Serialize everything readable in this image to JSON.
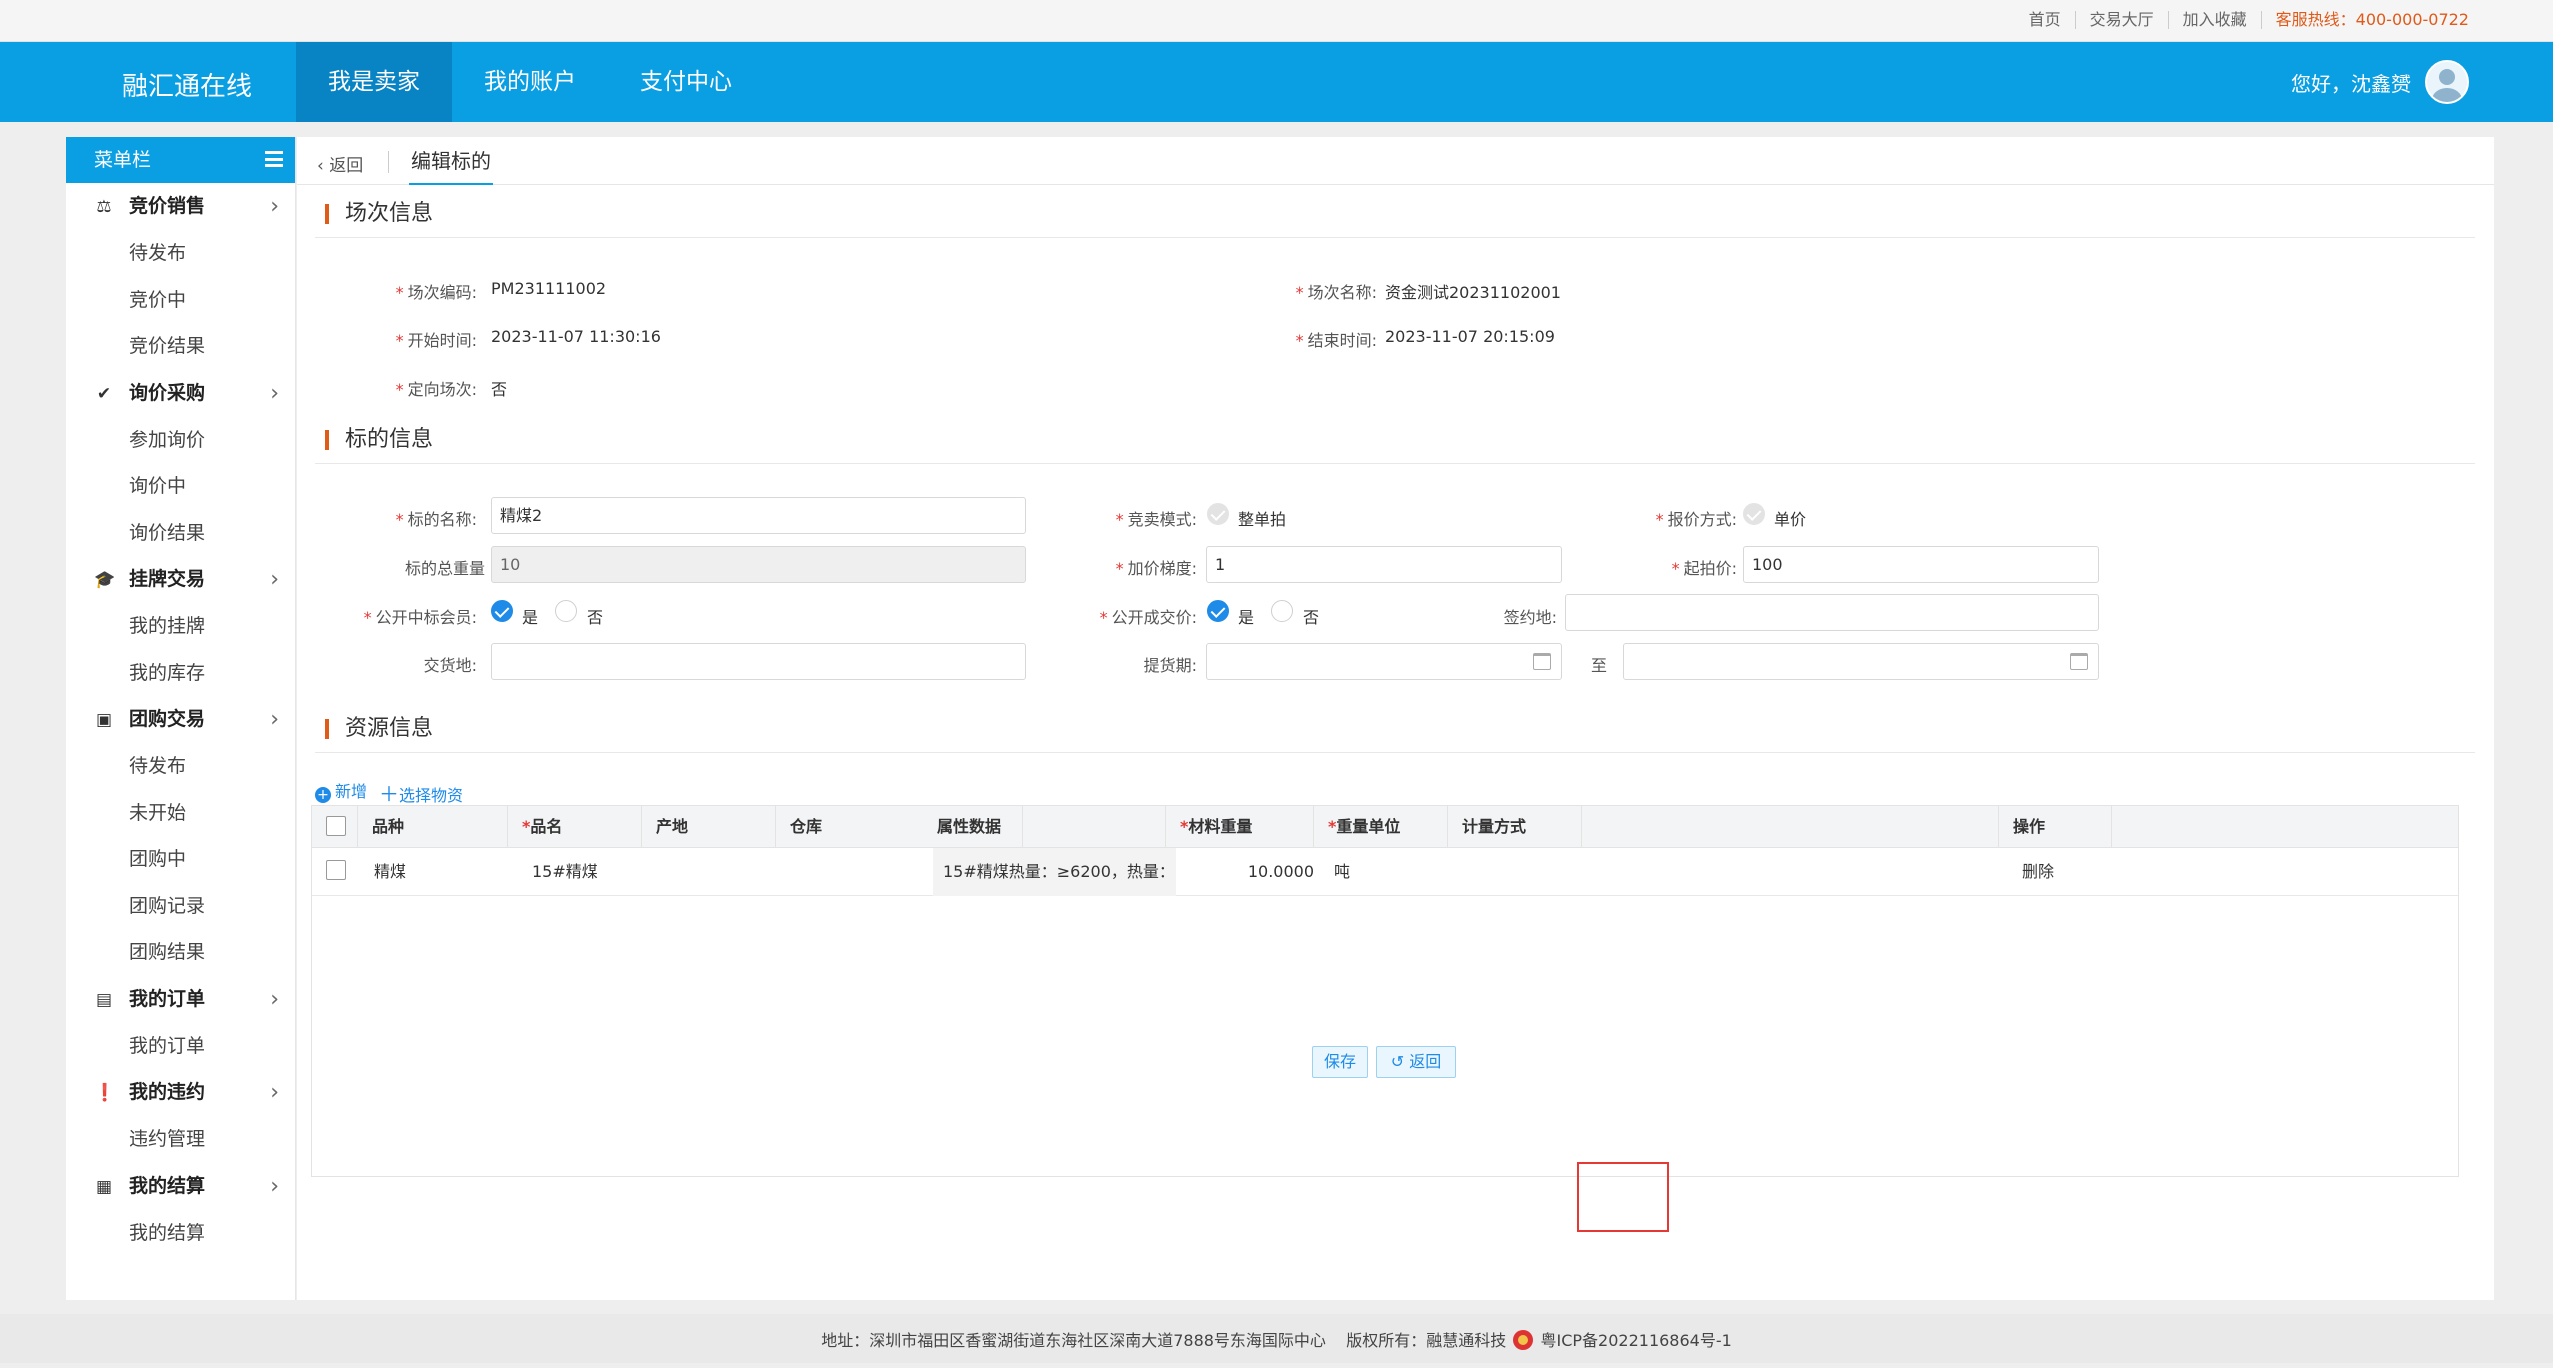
{
  "topbar": {
    "home": "首页",
    "trade_hall": "交易大厅",
    "favorite": "加入收藏",
    "hotline": "客服热线：400-000-0722"
  },
  "header": {
    "brand": "融汇通在线",
    "nav": [
      "我是卖家",
      "我的账户",
      "支付中心"
    ],
    "greeting": "您好，沈鑫赟"
  },
  "sidebar": {
    "title": "菜单栏",
    "groups": [
      {
        "label": "竞价销售",
        "icon": "gavel-icon",
        "items": [
          "待发布",
          "竞价中",
          "竞价结果"
        ]
      },
      {
        "label": "询价采购",
        "icon": "check-circle-icon",
        "items": [
          "参加询价",
          "询价中",
          "询价结果"
        ]
      },
      {
        "label": "挂牌交易",
        "icon": "graduation-cap-icon",
        "items": [
          "我的挂牌",
          "我的库存"
        ]
      },
      {
        "label": "团购交易",
        "icon": "cart-box-icon",
        "items": [
          "待发布",
          "未开始",
          "团购中",
          "团购记录",
          "团购结果"
        ]
      },
      {
        "label": "我的订单",
        "icon": "document-icon",
        "items": [
          "我的订单"
        ]
      },
      {
        "label": "我的违约",
        "icon": "alert-icon",
        "items": [
          "违约管理"
        ]
      },
      {
        "label": "我的结算",
        "icon": "calculator-icon",
        "items": [
          "我的结算"
        ]
      }
    ]
  },
  "tabs": {
    "back": "返回",
    "current": "编辑标的"
  },
  "session_info": {
    "title": "场次信息",
    "code_label": "场次编码:",
    "code": "PM231111002",
    "name_label": "场次名称:",
    "name": "资金测试20231102001",
    "start_label": "开始时间:",
    "start": "2023-11-07 11:30:16",
    "end_label": "结束时间:",
    "end": "2023-11-07 20:15:09",
    "directed_label": "定向场次:",
    "directed": "否"
  },
  "target_info": {
    "title": "标的信息",
    "name_label": "标的名称:",
    "name": "精煤2",
    "mode_label": "竞卖模式:",
    "mode": "整单拍",
    "quote_label": "报价方式:",
    "quote": "单价",
    "total_label": "标的总重量",
    "total": "10",
    "step_label": "加价梯度:",
    "step": "1",
    "start_price_label": "起拍价:",
    "start_price": "100",
    "public_winner_label": "公开中标会员:",
    "public_price_label": "公开成交价:",
    "yes": "是",
    "no": "否",
    "sign_place_label": "签约地:",
    "delivery_place_label": "交货地:",
    "pickup_label": "提货期:",
    "to": "至"
  },
  "resource_info": {
    "title": "资源信息",
    "add": "新增",
    "select": "选择物资",
    "columns": [
      "品种",
      "品名",
      "产地",
      "仓库",
      "属性数据",
      "材料重量",
      "重量单位",
      "计量方式",
      "操作"
    ],
    "rows": [
      {
        "variety": "精煤",
        "product": "15#精煤",
        "origin": "",
        "warehouse": "",
        "attr": "15#精煤热量：≥6200，热量：...",
        "weight": "10.0000",
        "unit": "吨",
        "measure": "",
        "action": "删除"
      }
    ]
  },
  "actions": {
    "save": "保存",
    "back": "返回"
  },
  "footer": {
    "address": "地址：深圳市福田区香蜜湖街道东海社区深南大道7888号东海国际中心",
    "copyright": "版权所有：融慧通科技",
    "icp": "粤ICP备2022116864号-1"
  }
}
